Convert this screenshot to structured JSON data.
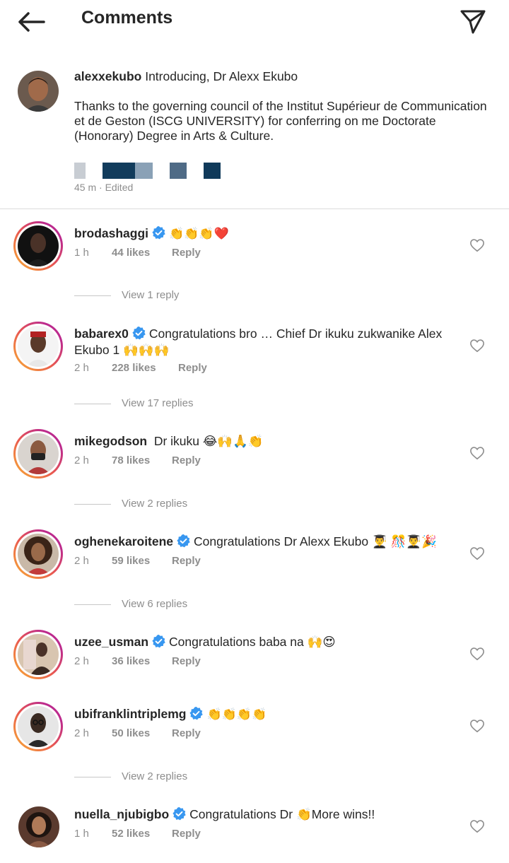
{
  "header": {
    "title": "Comments"
  },
  "caption": {
    "username": "alexxekubo",
    "headline": "Introducing, Dr Alexx Ekubo",
    "text": "Thanks to the governing council of the Institut Supérieur de Communication et de Geston (ISCG UNIVERSITY) for conferring on me Doctorate (Honorary) Degree in Arts & Culture.",
    "time": "45 m",
    "edited": "· Edited"
  },
  "comments": [
    {
      "username": "brodashaggi",
      "verified": true,
      "text": "👏👏👏❤️",
      "time": "1 h",
      "likes": "44 likes",
      "reply": "Reply",
      "view_replies": "View 1 reply"
    },
    {
      "username": "babarex0",
      "verified": true,
      "text": "Congratulations bro … Chief Dr ikuku zukwanike Alex Ekubo 1 🙌🙌🙌",
      "time": "2 h",
      "likes": "228 likes",
      "reply": "Reply",
      "view_replies": "View 17 replies"
    },
    {
      "username": "mikegodson",
      "verified": false,
      "text": "Dr ikuku 😂🙌🙏👏",
      "time": "2 h",
      "likes": "78 likes",
      "reply": "Reply",
      "view_replies": "View 2 replies"
    },
    {
      "username": "oghenekaroitene",
      "verified": true,
      "text": "Congratulations Dr Alexx Ekubo 👨‍🎓 🎊👨‍🎓🎉",
      "time": "2 h",
      "likes": "59 likes",
      "reply": "Reply",
      "view_replies": "View 6 replies"
    },
    {
      "username": "uzee_usman",
      "verified": true,
      "text": "Congratulations baba na 🙌😍",
      "time": "2 h",
      "likes": "36 likes",
      "reply": "Reply"
    },
    {
      "username": "ubifranklintriplemg",
      "verified": true,
      "text": "👏👏👏👏",
      "time": "2 h",
      "likes": "50 likes",
      "reply": "Reply",
      "view_replies": "View 2 replies"
    },
    {
      "username": "nuella_njubigbo",
      "verified": true,
      "text": "Congratulations Dr 👏More wins!!",
      "time": "1 h",
      "likes": "52 likes",
      "reply": "Reply"
    }
  ],
  "colors": {
    "text": "#262626",
    "secondary": "#8e8e8e",
    "verified": "#3897f0",
    "divider": "#dbdbdb"
  },
  "icons": {
    "back": "arrow-left-icon",
    "send": "paper-plane-icon",
    "like": "heart-outline-icon",
    "verified": "verified-badge-icon"
  }
}
